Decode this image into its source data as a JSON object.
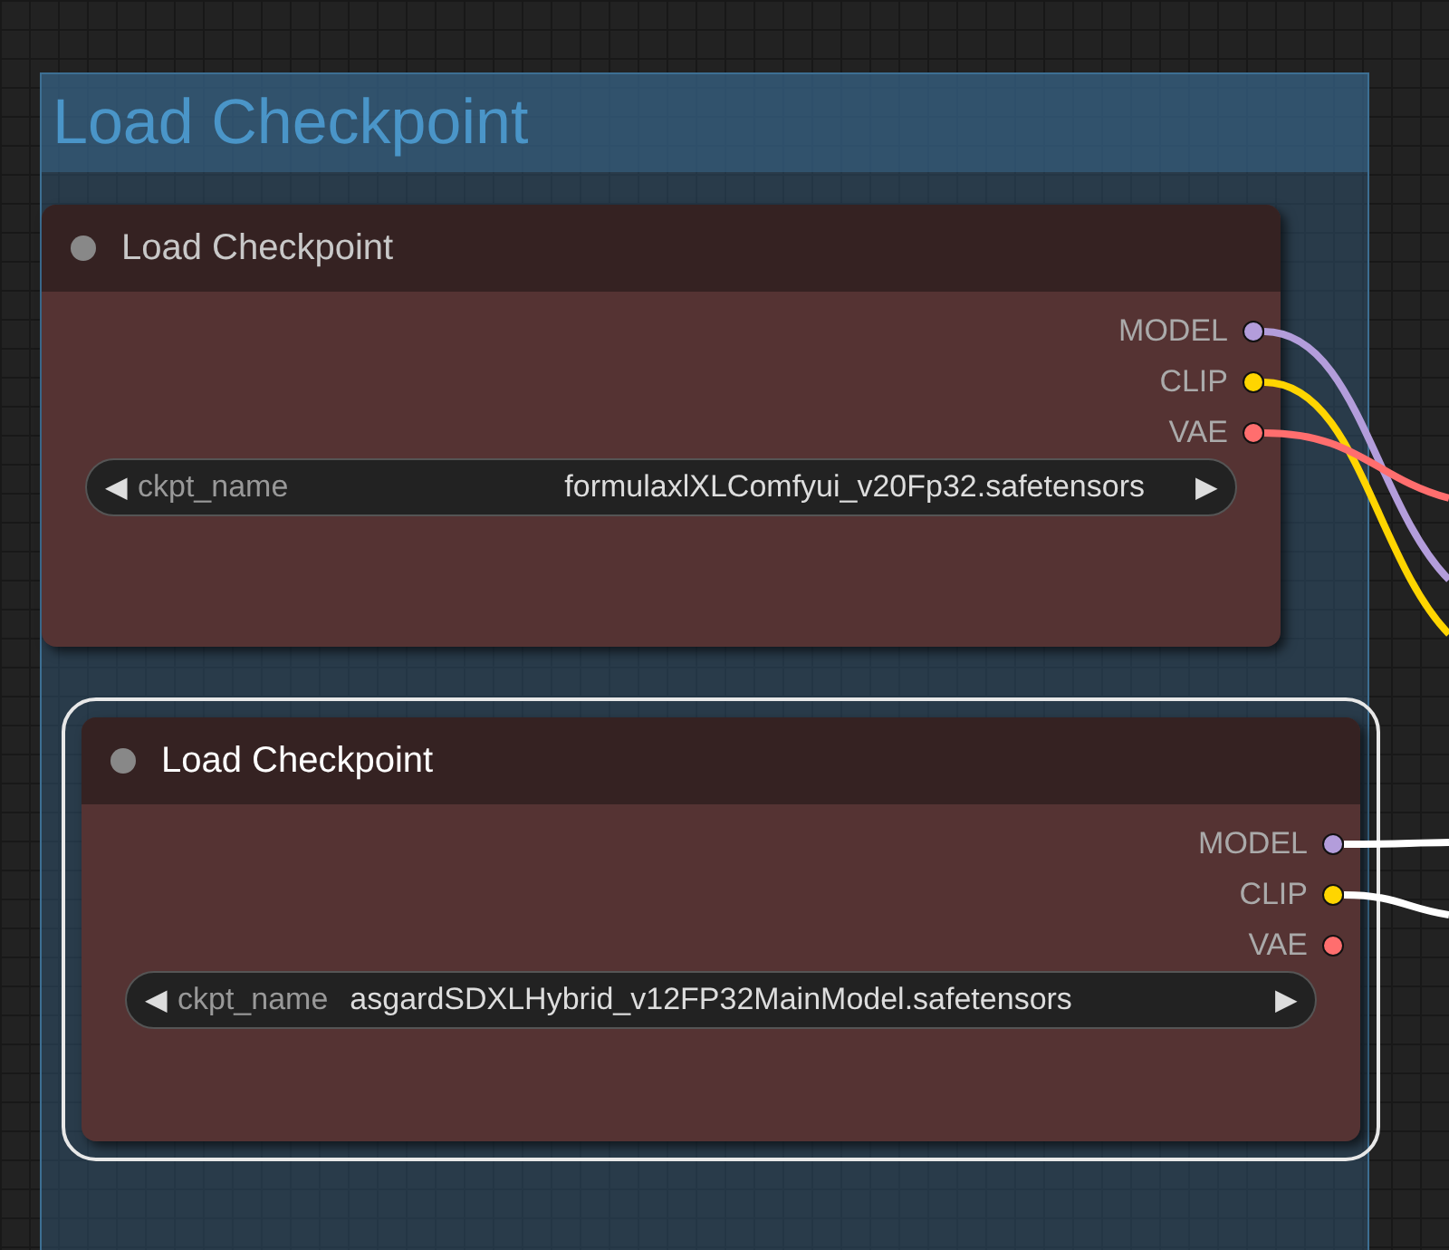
{
  "group": {
    "title": "Load Checkpoint"
  },
  "nodes": [
    {
      "title": "Load Checkpoint",
      "selected": false,
      "outputs": [
        {
          "name": "MODEL",
          "color": "#b39ddb",
          "linked": true
        },
        {
          "name": "CLIP",
          "color": "#ffd500",
          "linked": true
        },
        {
          "name": "VAE",
          "color": "#ff6e6e",
          "linked": true
        }
      ],
      "widget": {
        "label": "ckpt_name",
        "value": "formulaxlXLComfyui_v20Fp32.safetensors",
        "left": "◀",
        "right": "▶"
      }
    },
    {
      "title": "Load Checkpoint",
      "selected": true,
      "outputs": [
        {
          "name": "MODEL",
          "color": "#b39ddb",
          "linked": true
        },
        {
          "name": "CLIP",
          "color": "#ffd500",
          "linked": true
        },
        {
          "name": "VAE",
          "color": "#ff6e6e",
          "linked": false
        }
      ],
      "widget": {
        "label": "ckpt_name",
        "value": "asgardSDXLHybrid_v12FP32MainModel.safetensors",
        "left": "◀",
        "right": "▶"
      }
    }
  ]
}
